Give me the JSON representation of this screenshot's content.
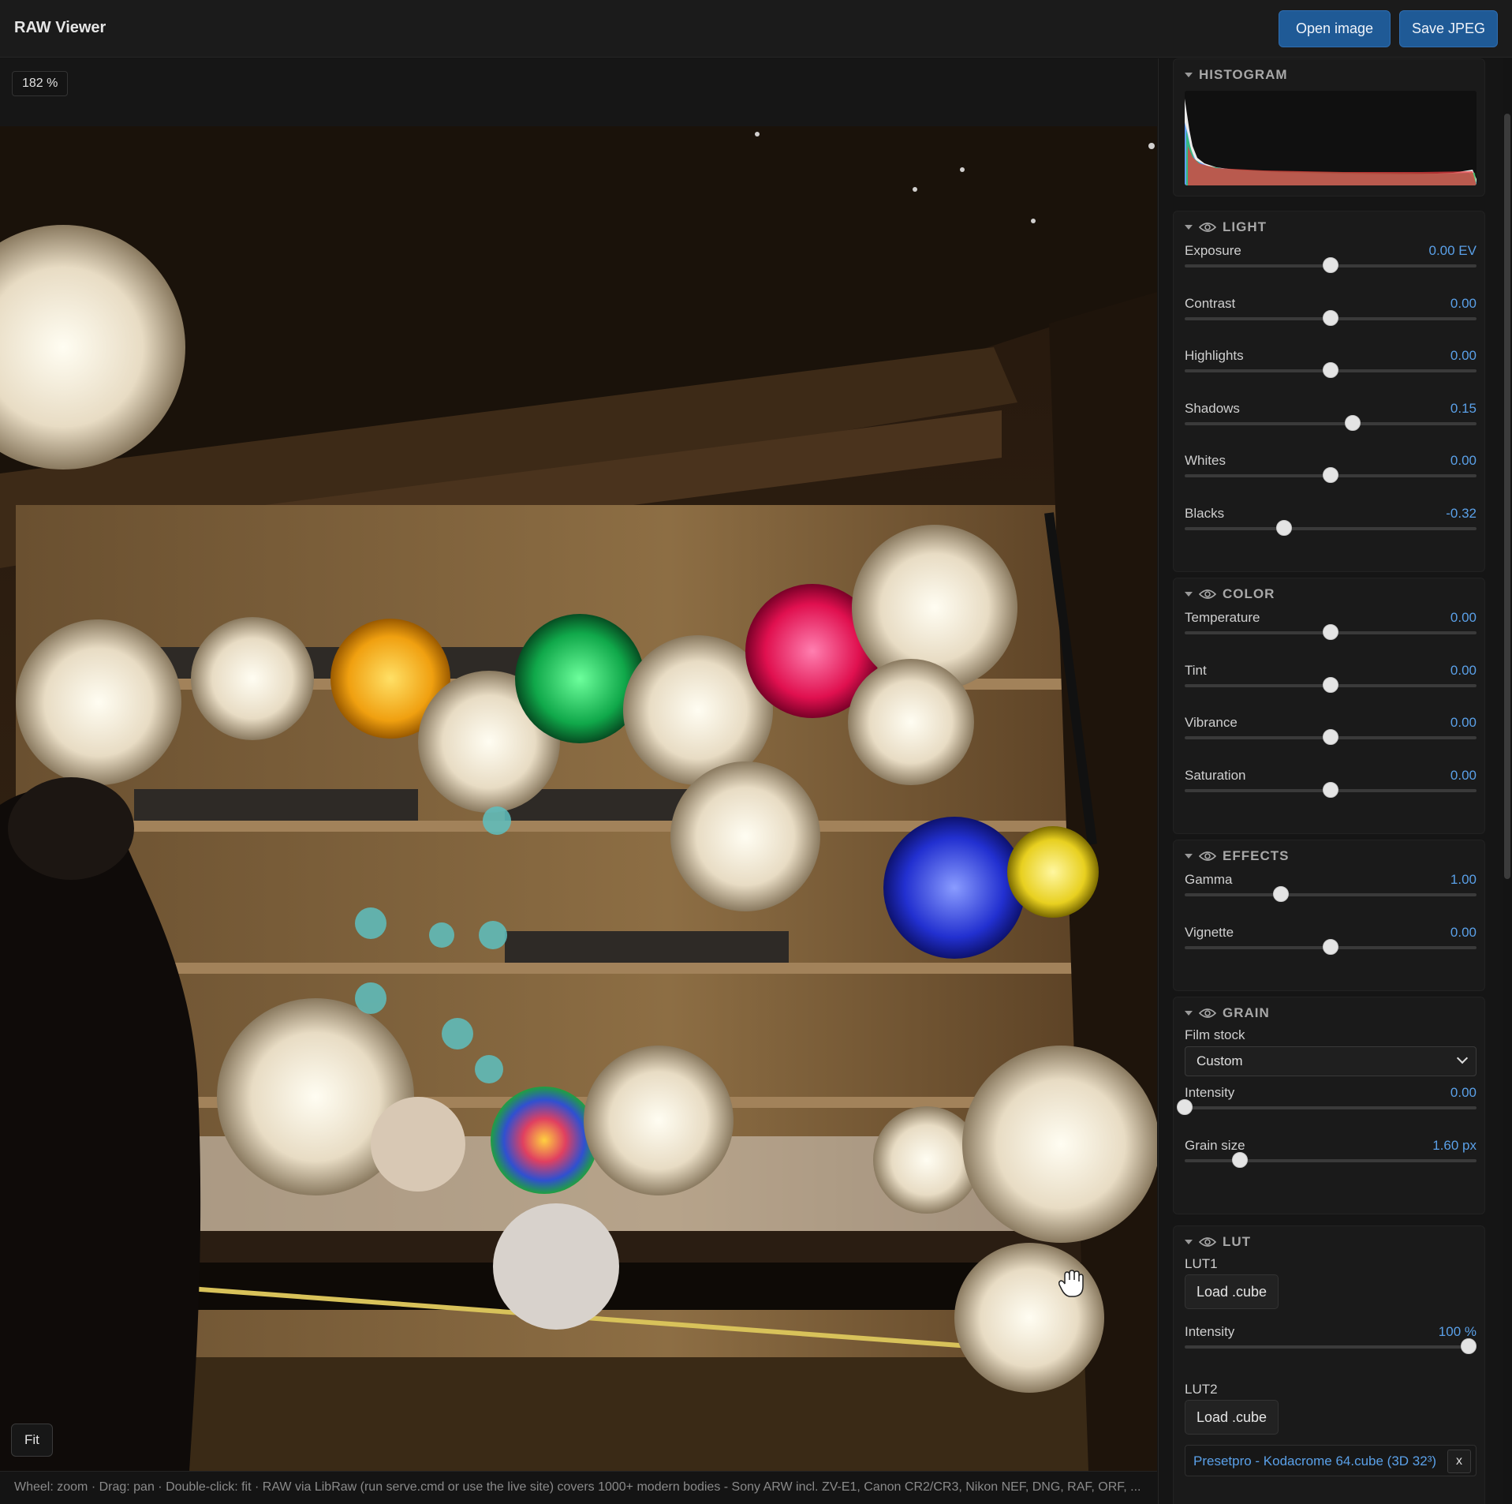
{
  "app": {
    "title": "RAW Viewer"
  },
  "toolbar": {
    "open_label": "Open image",
    "save_label": "Save JPEG"
  },
  "viewer": {
    "zoom": "182 %",
    "fit_label": "Fit",
    "cursor_icon": "grab-hand-icon"
  },
  "status": "Wheel: zoom · Drag: pan · Double-click: fit · RAW via LibRaw (run serve.cmd or use the live site) covers 1000+ modern bodies - Sony ARW incl. ZV-E1, Canon CR2/CR3, Nikon NEF, DNG, RAF, ORF, ...",
  "colors": {
    "accent": "#5aa0e8",
    "primary_button": "#1f5a96",
    "panel_bg": "#1a1a1a",
    "page_bg": "#141414"
  },
  "sections": {
    "histogram": {
      "title": "HISTOGRAM"
    },
    "light": {
      "title": "LIGHT",
      "sliders": [
        {
          "label": "Exposure",
          "value": "0.00 EV",
          "level": 0.5
        },
        {
          "label": "Contrast",
          "value": "0.00",
          "level": 0.5
        },
        {
          "label": "Highlights",
          "value": "0.00",
          "level": 0.5
        },
        {
          "label": "Shadows",
          "value": "0.15",
          "level": 0.575
        },
        {
          "label": "Whites",
          "value": "0.00",
          "level": 0.5
        },
        {
          "label": "Blacks",
          "value": "-0.32",
          "level": 0.34
        }
      ]
    },
    "color": {
      "title": "COLOR",
      "sliders": [
        {
          "label": "Temperature",
          "value": "0.00",
          "level": 0.5
        },
        {
          "label": "Tint",
          "value": "0.00",
          "level": 0.5
        },
        {
          "label": "Vibrance",
          "value": "0.00",
          "level": 0.5
        },
        {
          "label": "Saturation",
          "value": "0.00",
          "level": 0.5
        }
      ]
    },
    "effects": {
      "title": "EFFECTS",
      "sliders": [
        {
          "label": "Gamma",
          "value": "1.00",
          "level": 0.33
        },
        {
          "label": "Vignette",
          "value": "0.00",
          "level": 0.5
        }
      ]
    },
    "grain": {
      "title": "GRAIN",
      "film_stock_label": "Film stock",
      "film_stock_value": "Custom",
      "sliders": [
        {
          "label": "Intensity",
          "value": "0.00",
          "level": 0.0
        },
        {
          "label": "Grain size",
          "value": "1.60 px",
          "level": 0.19
        }
      ]
    },
    "lut": {
      "title": "LUT",
      "lut1_label": "LUT1",
      "lut1_button": "Load .cube",
      "intensity_label": "Intensity",
      "intensity_value": "100 %",
      "intensity_level": 1.0,
      "lut2_label": "LUT2",
      "lut2_button": "Load .cube",
      "lut2_file": "Presetpro - Kodacrome 64.cube (3D 32³)",
      "lut2_clear": "x"
    }
  }
}
